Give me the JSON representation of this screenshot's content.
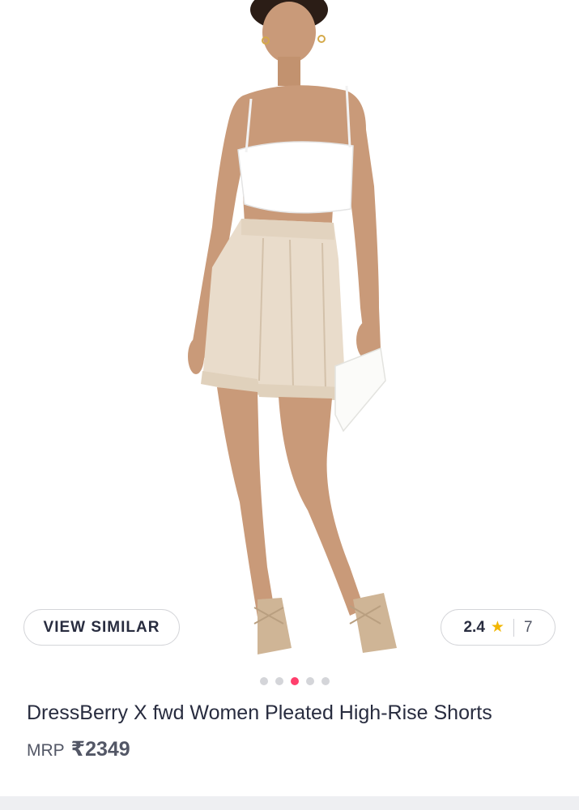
{
  "product": {
    "title": "DressBerry X fwd Women Pleated High-Rise Shorts",
    "mrp_label": "MRP",
    "price": "₹2349"
  },
  "actions": {
    "view_similar_label": "VIEW SIMILAR"
  },
  "rating": {
    "value": "2.4",
    "star": "★",
    "count": "7"
  },
  "carousel": {
    "total": 5,
    "active_index": 2
  },
  "colors": {
    "accent": "#ff3f6c",
    "star": "#f2b600",
    "text": "#282c3f",
    "muted": "#535766"
  }
}
